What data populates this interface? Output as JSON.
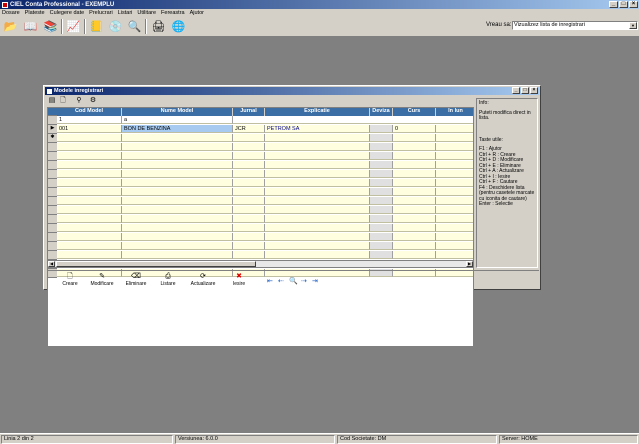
{
  "app": {
    "title": "CIEL Conta Professional - EXEMPLU"
  },
  "menubar": [
    "Dosare",
    "Plateste",
    "Culegere date",
    "Prelucrari",
    "Listari",
    "Utilitare",
    "Fereastra",
    "Ajutor"
  ],
  "toolbar": {
    "view_label": "Vreau sa:",
    "view_value": "Vizualizez lista de inregistrari"
  },
  "dialog": {
    "title": "Modele inregistrari",
    "columns": [
      "Cod Model",
      "Nume Model",
      "Jurnal",
      "Explicatie",
      "Deviza",
      "Curs",
      "In lun"
    ],
    "filter_row": [
      "1",
      "a"
    ],
    "rows": [
      {
        "cod": "001",
        "nume": "BON DE BENZINA",
        "jurnal": "JCR",
        "explicatie": "PETROM SA",
        "deviza": "",
        "curs": "0"
      }
    ],
    "info": {
      "title": "Info:",
      "text": "Puteti modifica direct in lista.",
      "shortcuts_title": "Taste utile:",
      "shortcuts": [
        "F1 : Ajutor",
        "Ctrl + R : Creare",
        "Ctrl + D : Modificare",
        "Ctrl + E : Eliminare",
        "Ctrl + A : Actualizare",
        "Ctrl + I : Iesire",
        "Ctrl + F : Cautare",
        "F4 : Deschidere lista (pentru casetele marcate cu iconita de cautare)",
        "Enter : Selectie"
      ]
    },
    "buttons": {
      "create": "Creare",
      "modify": "Modificare",
      "delete": "Eliminare",
      "list": "Listare",
      "update": "Actualizare",
      "exit": "Iesire"
    }
  },
  "statusbar": {
    "line": "Linia 2 din 2",
    "version": "Versiunea: 6.0.0",
    "company": "Cod Societate: DM",
    "server": "Server: HOME"
  }
}
